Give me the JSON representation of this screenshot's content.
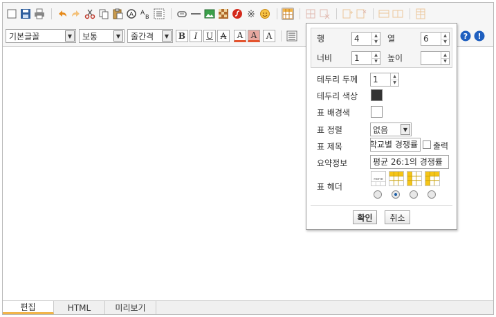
{
  "font_select": {
    "value": "기본글꼴"
  },
  "size_select": {
    "value": "보통"
  },
  "linespace_select": {
    "value": "줄간격"
  },
  "format_buttons": {
    "bold": "B",
    "italic": "I",
    "underline": "U",
    "strike": "A",
    "fontcolor": "A",
    "bgcolor": "A",
    "clear": "A"
  },
  "tabs": [
    {
      "label": "편집",
      "selected": true
    },
    {
      "label": "HTML",
      "selected": false
    },
    {
      "label": "미리보기",
      "selected": false
    }
  ],
  "table_dialog": {
    "rows_label": "행",
    "rows_value": "4",
    "cols_label": "열",
    "cols_value": "6",
    "width_label": "너비",
    "width_value": "1",
    "height_label": "높이",
    "height_value": "",
    "border_width_label": "테두리 두께",
    "border_width_value": "1",
    "border_color_label": "테두리 색상",
    "border_color": "#333333",
    "bg_label": "표 배경색",
    "bg_color": "#ffffff",
    "align_label": "표 정렬",
    "align_value": "없음",
    "caption_label": "표 제목",
    "caption_value": "학교별 경쟁률",
    "caption_print_label": "출력",
    "summary_label": "요약정보",
    "summary_value": "평균 26:1의 경쟁률",
    "header_label": "표 헤더",
    "header_none_text": "none",
    "header_selected_index": 1,
    "ok_label": "확인",
    "cancel_label": "취소"
  },
  "colors": {
    "accent_yellow": "#f2b54a",
    "help_blue": "#1f5fbf",
    "info_blue": "#1f5fbf"
  }
}
